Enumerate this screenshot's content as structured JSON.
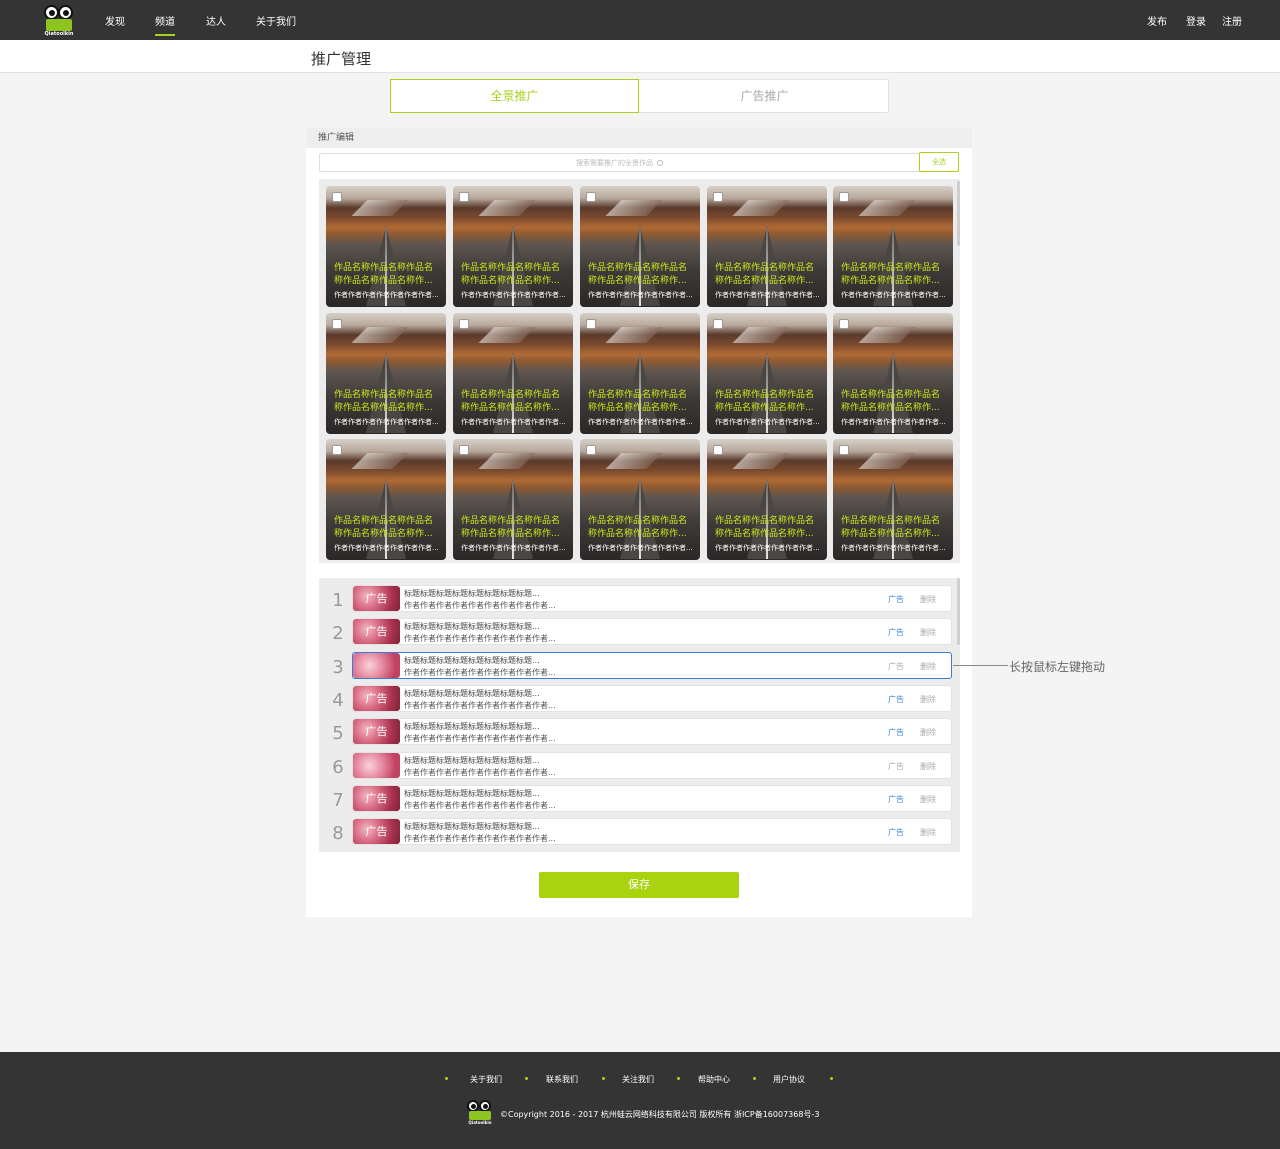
{
  "nav": {
    "logo_text": "Qiatoolkin",
    "items": [
      {
        "label": "发现",
        "active": false
      },
      {
        "label": "频道",
        "active": true
      },
      {
        "label": "达人",
        "active": false
      },
      {
        "label": "关于我们",
        "active": false
      }
    ],
    "right": [
      "发布",
      "登录",
      "注册"
    ],
    "accent_color": "#a4d31a"
  },
  "page": {
    "title": "推广管理"
  },
  "tabs": [
    {
      "label": "全景推广",
      "active": true
    },
    {
      "label": "广告推广",
      "active": false
    }
  ],
  "editor": {
    "heading": "推广编辑",
    "search_placeholder": "搜索需要推广的全景作品",
    "select_all": "全选",
    "cards": {
      "name": "作品名称作品名称作品名称作品名称作品名称作...",
      "author": "作者作者作者作者作者作者作者..."
    }
  },
  "list": {
    "items": [
      {
        "num": "1",
        "thumb": "广告",
        "title": "标题标题标题标题标题标题标题标题...",
        "author": "作者作者作者作者作者作者作者作者作者...",
        "ad": "广告",
        "ad_on": true,
        "del": "删除"
      },
      {
        "num": "2",
        "thumb": "广告",
        "title": "标题标题标题标题标题标题标题标题...",
        "author": "作者作者作者作者作者作者作者作者作者...",
        "ad": "广告",
        "ad_on": true,
        "del": "删除"
      },
      {
        "num": "3",
        "thumb": "",
        "title": "标题标题标题标题标题标题标题标题...",
        "author": "作者作者作者作者作者作者作者作者作者...",
        "ad": "广告",
        "ad_on": false,
        "del": "删除",
        "dragging": true
      },
      {
        "num": "4",
        "thumb": "广告",
        "title": "标题标题标题标题标题标题标题标题...",
        "author": "作者作者作者作者作者作者作者作者作者...",
        "ad": "广告",
        "ad_on": true,
        "del": "删除"
      },
      {
        "num": "5",
        "thumb": "广告",
        "title": "标题标题标题标题标题标题标题标题...",
        "author": "作者作者作者作者作者作者作者作者作者...",
        "ad": "广告",
        "ad_on": true,
        "del": "删除"
      },
      {
        "num": "6",
        "thumb": "",
        "title": "标题标题标题标题标题标题标题标题...",
        "author": "作者作者作者作者作者作者作者作者作者...",
        "ad": "广告",
        "ad_on": false,
        "del": "删除"
      },
      {
        "num": "7",
        "thumb": "广告",
        "title": "标题标题标题标题标题标题标题标题...",
        "author": "作者作者作者作者作者作者作者作者作者...",
        "ad": "广告",
        "ad_on": true,
        "del": "删除"
      },
      {
        "num": "8",
        "thumb": "广告",
        "title": "标题标题标题标题标题标题标题标题...",
        "author": "作者作者作者作者作者作者作者作者作者...",
        "ad": "广告",
        "ad_on": true,
        "del": "删除"
      }
    ],
    "drag_hint": "长按鼠标左键拖动",
    "ad_on_color": "#3a87d6"
  },
  "save_label": "保存",
  "footer": {
    "links": [
      "关于我们",
      "联系我们",
      "关注我们",
      "帮助中心",
      "用户协议"
    ],
    "copyright": "©Copyright 2016 - 2017 杭州蛙云网络科技有限公司 版权所有 浙ICP备16007368号-3",
    "logo_text": "Qiatoolkin"
  }
}
